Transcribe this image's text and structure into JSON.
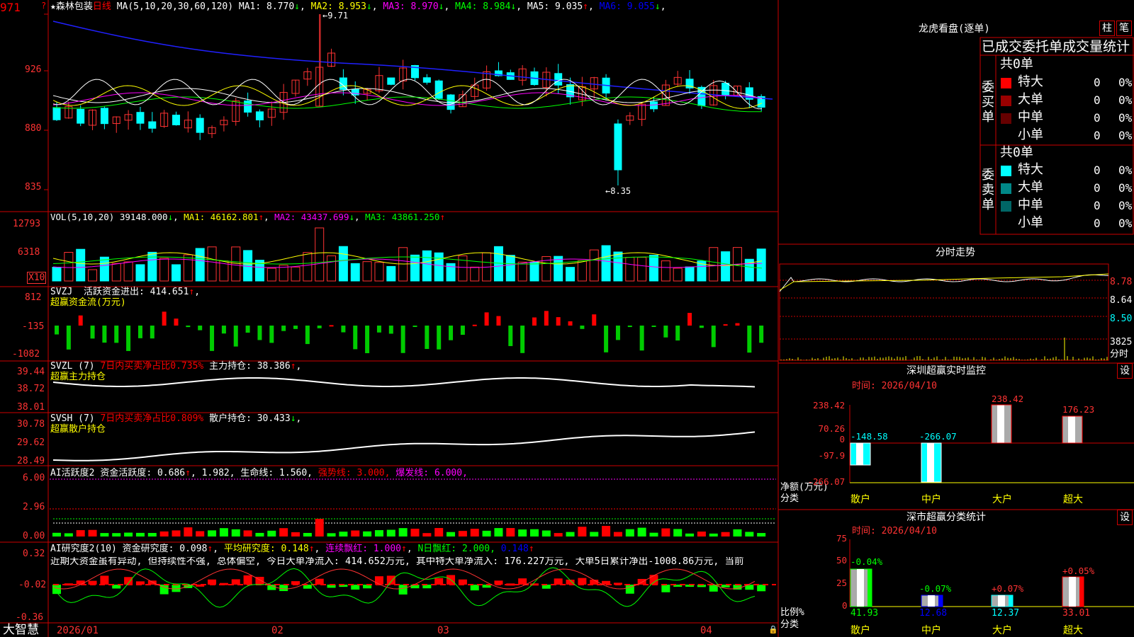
{
  "stock": {
    "name": "森林包装",
    "period": "日线",
    "ma_params": "MA(5,10,20,30,60,120)"
  },
  "main": {
    "y_ticks": [
      "971",
      "926",
      "880",
      "835"
    ],
    "ma": [
      {
        "label": "MA1:",
        "value": "8.770",
        "arrow": "↓",
        "color": "#ffffff"
      },
      {
        "label": "MA2:",
        "value": "8.953",
        "arrow": "↓",
        "color": "#ffff00"
      },
      {
        "label": "MA3:",
        "value": "8.970",
        "arrow": "↓",
        "color": "#ff00ff"
      },
      {
        "label": "MA4:",
        "value": "8.984",
        "arrow": "↓",
        "color": "#00ff00"
      },
      {
        "label": "MA5:",
        "value": "9.035",
        "arrow": "↑",
        "color": "#ffffff"
      },
      {
        "label": "MA6:",
        "value": "9.055",
        "arrow": "↓",
        "color": "#0000ff"
      }
    ],
    "high_label": "9.71",
    "low_label": "8.35"
  },
  "vol": {
    "header_name": "VOL(5,10,20)",
    "value": "39148.000",
    "arrow": "↓",
    "ma1": "MA1: 46162.801",
    "ma1_arrow": "↑",
    "ma2": "MA2: 43437.699",
    "ma2_arrow": "↓",
    "ma3": "MA3: 43861.250",
    "ma3_arrow": "↑",
    "y_ticks": [
      "12793",
      "6318"
    ],
    "multiplier": "X10"
  },
  "svzj": {
    "name": "SVZJ",
    "label": "活跃资金进出: 414.651",
    "arrow": "↑",
    "subtitle": "超赢资金流(万元)",
    "y_ticks": [
      "812",
      "-135",
      "-1082"
    ]
  },
  "svzl": {
    "name": "SVZL (7)",
    "ratio": "7日内买卖净占比0.735%",
    "hold": "主力持仓: 38.386",
    "arrow": "↑",
    "subtitle": "超赢主力持仓",
    "y_ticks": [
      "39.44",
      "38.72",
      "38.01"
    ]
  },
  "svsh": {
    "name": "SVSH (7)",
    "ratio": "7日内买卖净占比0.809%",
    "hold": "散户持仓: 30.433",
    "arrow": "↓",
    "subtitle": "超赢散户持仓",
    "y_ticks": [
      "30.78",
      "29.62",
      "28.49"
    ]
  },
  "ai2": {
    "name": "AI活跃度2",
    "label": "资金活跃度: 0.686",
    "v2": "1.982,",
    "life": "生命线: 1.560,",
    "strong": "强势线: 3.000,",
    "burst": "爆发线: 6.000,",
    "y_ticks": [
      "6.00",
      "2.96",
      "0.00"
    ]
  },
  "ai_research": {
    "name": "AI研究度2(10)",
    "label": "资金研究度: 0.098",
    "avg": "平均研究度: 0.148",
    "consec": "连续飘红: 1.000",
    "nday": "N日飘红: 2.000,",
    "last": "0.148",
    "y_ticks": [
      "0.32",
      "-0.02",
      "-0.36"
    ],
    "comment": "近期大资金虽有异动, 但持续性不强, 总体偏空, 今日大单净流入: 414.652万元, 其中特大单净流入: 176.227万元, 大单5日累计净出-1008.86万元, 当前"
  },
  "x_axis": {
    "labels": [
      "2026/01",
      "02",
      "03",
      "04"
    ],
    "brand": "大智慧"
  },
  "longhu": {
    "title": "龙虎看盘(逐单)",
    "btn1": "柱",
    "btn2": "笔",
    "subtitle": "已成交委托单成交量统计",
    "buy_side": "委买单",
    "sell_side": "委卖单",
    "buy_total": "共0单",
    "sell_total": "共0单",
    "buy_rows": [
      {
        "label": "特大",
        "count": "0",
        "pct": "0%",
        "color": "#ff0000"
      },
      {
        "label": "大单",
        "count": "0",
        "pct": "0%",
        "color": "#990000"
      },
      {
        "label": "中单",
        "count": "0",
        "pct": "0%",
        "color": "#660000"
      },
      {
        "label": "小单",
        "count": "0",
        "pct": "0%",
        "color": ""
      }
    ],
    "sell_rows": [
      {
        "label": "特大",
        "count": "0",
        "pct": "0%",
        "color": "#00ffff"
      },
      {
        "label": "大单",
        "count": "0",
        "pct": "0%",
        "color": "#008888"
      },
      {
        "label": "中单",
        "count": "0",
        "pct": "0%",
        "color": "#006666"
      },
      {
        "label": "小单",
        "count": "0",
        "pct": "0%",
        "color": ""
      }
    ]
  },
  "intraday": {
    "title": "分时走势",
    "y_ticks": [
      "8.78",
      "8.64",
      "8.50"
    ],
    "vol_tick": "3825",
    "vol_unit": "分时"
  },
  "monitor": {
    "title": "深圳超赢实时监控",
    "settings": "设",
    "time": "时间: 2026/04/10",
    "y_ticks": [
      "238.42",
      "70.26",
      "0",
      "-97.9",
      "-266.07"
    ],
    "y_label1": "净额(万元)",
    "y_label2": "分类",
    "categories": [
      "散户",
      "中户",
      "大户",
      "超大"
    ],
    "values": [
      "-148.58",
      "-266.07",
      "238.42",
      "176.23"
    ]
  },
  "classify": {
    "title": "深市超赢分类统计",
    "settings": "设",
    "time": "时间: 2026/04/10",
    "y_ticks": [
      "75",
      "50",
      "25",
      "0"
    ],
    "y_label1": "比例%",
    "y_label2": "分类",
    "categories": [
      "散户",
      "中户",
      "大户",
      "超大"
    ],
    "pct_change": [
      "-0.04%",
      "-0.07%",
      "+0.07%",
      "+0.05%"
    ],
    "values": [
      "41.93",
      "12.68",
      "12.37",
      "33.01"
    ]
  }
}
